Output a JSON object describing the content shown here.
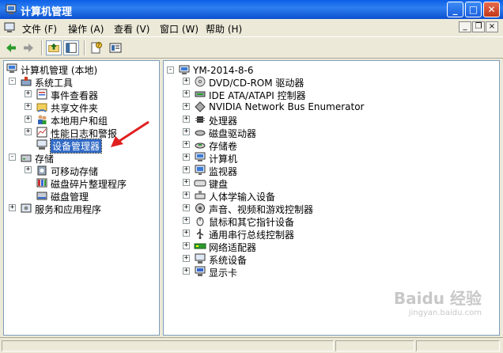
{
  "window": {
    "title": "计算机管理",
    "controls": {
      "minimize": "_",
      "maximize": "□",
      "close": "✕"
    }
  },
  "menu": [
    "文件 (F)",
    "操作 (A)",
    "查看 (V)",
    "窗口 (W)",
    "帮助 (H)"
  ],
  "left_tree": {
    "root": "计算机管理 (本地)",
    "items": [
      {
        "label": "系统工具",
        "level": 1,
        "expander": "-",
        "icon": "tools-icon"
      },
      {
        "label": "事件查看器",
        "level": 2,
        "expander": "+",
        "icon": "event-viewer-icon"
      },
      {
        "label": "共享文件夹",
        "level": 2,
        "expander": "+",
        "icon": "shared-folder-icon"
      },
      {
        "label": "本地用户和组",
        "level": 2,
        "expander": "+",
        "icon": "users-icon"
      },
      {
        "label": "性能日志和警报",
        "level": 2,
        "expander": "+",
        "icon": "performance-icon"
      },
      {
        "label": "设备管理器",
        "level": 2,
        "expander": "",
        "icon": "device-manager-icon",
        "selected": true
      },
      {
        "label": "存储",
        "level": 1,
        "expander": "-",
        "icon": "storage-icon"
      },
      {
        "label": "可移动存储",
        "level": 2,
        "expander": "+",
        "icon": "removable-storage-icon"
      },
      {
        "label": "磁盘碎片整理程序",
        "level": 2,
        "expander": "",
        "icon": "defrag-icon"
      },
      {
        "label": "磁盘管理",
        "level": 2,
        "expander": "",
        "icon": "disk-management-icon"
      },
      {
        "label": "服务和应用程序",
        "level": 1,
        "expander": "+",
        "icon": "services-icon"
      }
    ]
  },
  "right_tree": {
    "root": "YM-2014-8-6",
    "items": [
      {
        "label": "DVD/CD-ROM 驱动器",
        "icon": "dvd-icon"
      },
      {
        "label": "IDE ATA/ATAPI 控制器",
        "icon": "ide-icon"
      },
      {
        "label": "NVIDIA Network Bus Enumerator",
        "icon": "nvidia-bus-icon"
      },
      {
        "label": "处理器",
        "icon": "processor-icon"
      },
      {
        "label": "磁盘驱动器",
        "icon": "disk-drive-icon"
      },
      {
        "label": "存储卷",
        "icon": "storage-volume-icon"
      },
      {
        "label": "计算机",
        "icon": "computer-icon"
      },
      {
        "label": "监视器",
        "icon": "monitor-icon"
      },
      {
        "label": "键盘",
        "icon": "keyboard-icon"
      },
      {
        "label": "人体学输入设备",
        "icon": "hid-icon"
      },
      {
        "label": "声音、视频和游戏控制器",
        "icon": "sound-icon"
      },
      {
        "label": "鼠标和其它指针设备",
        "icon": "mouse-icon"
      },
      {
        "label": "通用串行总线控制器",
        "icon": "usb-icon"
      },
      {
        "label": "网络适配器",
        "icon": "network-adapter-icon"
      },
      {
        "label": "系统设备",
        "icon": "system-device-icon"
      },
      {
        "label": "显示卡",
        "icon": "display-adapter-icon"
      }
    ]
  },
  "watermark": {
    "text": "Baidu 经验",
    "sub": "jingyan.baidu.com"
  },
  "colors": {
    "title_bar": "#0a5fe6",
    "selection": "#316ac5",
    "annotation_arrow": "#e02020"
  }
}
